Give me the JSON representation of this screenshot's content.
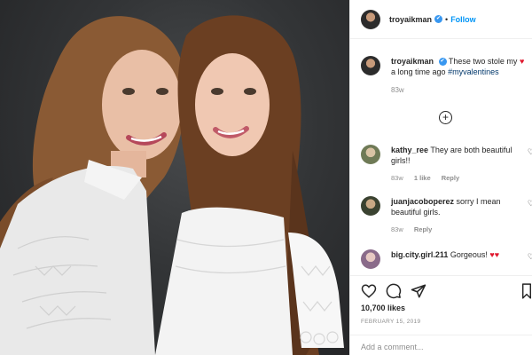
{
  "post": {
    "username": "troyaikman",
    "follow_label": "Follow",
    "separator": "•",
    "caption": {
      "username": "troyaikman",
      "text": "These two stole my",
      "text2": "a long time ago",
      "hashtag": "#myvalentines",
      "age": "83w"
    },
    "comments": [
      {
        "username": "kathy_ree",
        "text": "They are both beautiful girls!!",
        "age": "83w",
        "likes": "1 like",
        "reply": "Reply"
      },
      {
        "username": "juanjacoboperez",
        "text": "sorry I mean beautiful girls.",
        "age": "83w",
        "likes": "",
        "reply": "Reply"
      },
      {
        "username": "big.city.girl.211",
        "text": "Gorgeous!",
        "age": "",
        "likes": "",
        "reply": ""
      }
    ],
    "likes": "10,700 likes",
    "date": "FEBRUARY 15, 2019",
    "add_comment_placeholder": "Add a comment..."
  },
  "icons": [
    "heart-icon",
    "comment-icon",
    "share-icon",
    "bookmark-icon",
    "add-icon",
    "verified-icon"
  ],
  "colors": {
    "link": "#0095f6",
    "verified": "#3897f0",
    "heart": "#e0192f",
    "muted": "#8e8e8e"
  }
}
